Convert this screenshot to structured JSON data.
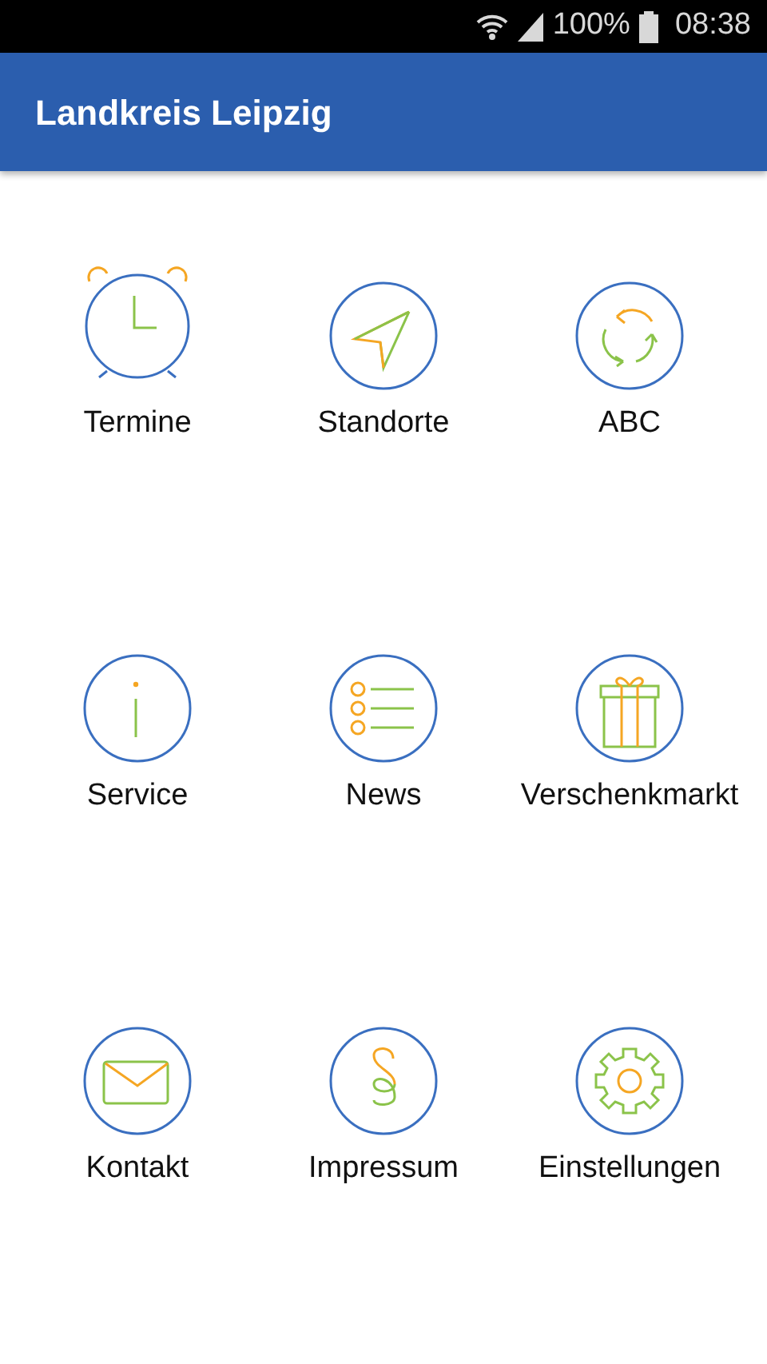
{
  "status_bar": {
    "battery": "100%",
    "time": "08:38"
  },
  "app_bar": {
    "title": "Landkreis Leipzig"
  },
  "tiles": [
    {
      "kind": "clock",
      "label": "Termine"
    },
    {
      "kind": "location",
      "label": "Standorte"
    },
    {
      "kind": "cycle",
      "label": "ABC"
    },
    {
      "kind": "info",
      "label": "Service"
    },
    {
      "kind": "list",
      "label": "News"
    },
    {
      "kind": "gift",
      "label": "Verschenkmarkt"
    },
    {
      "kind": "mail",
      "label": "Kontakt"
    },
    {
      "kind": "paragraph",
      "label": "Impressum"
    },
    {
      "kind": "gear",
      "label": "Einstellungen"
    }
  ]
}
